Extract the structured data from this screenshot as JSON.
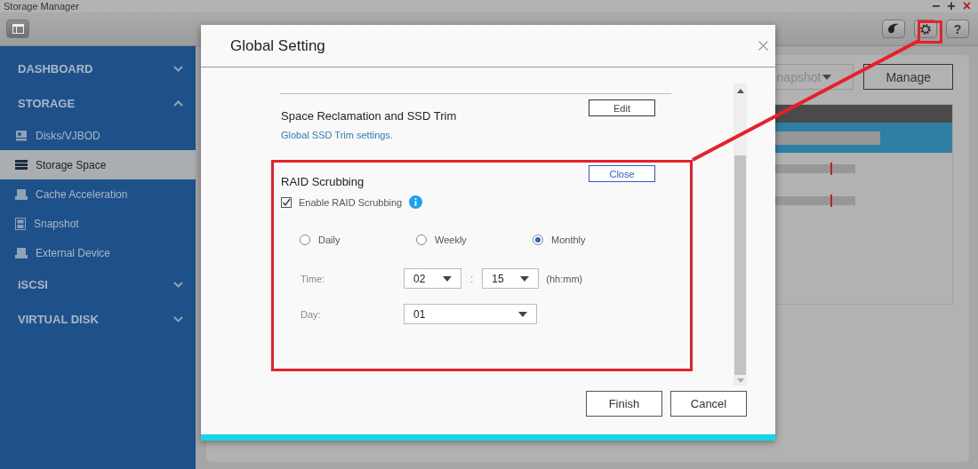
{
  "window": {
    "title": "Storage Manager",
    "controls": [
      "−",
      "+",
      "×"
    ]
  },
  "toolbar": {
    "help": "?"
  },
  "sidebar": {
    "sections": [
      {
        "label": "DASHBOARD",
        "expanded": false
      },
      {
        "label": "STORAGE",
        "expanded": true,
        "items": [
          {
            "label": "Disks/VJBOD",
            "selected": false
          },
          {
            "label": "Storage Space",
            "selected": true
          },
          {
            "label": "Cache Acceleration",
            "selected": false
          },
          {
            "label": "Snapshot",
            "selected": false
          },
          {
            "label": "External Device",
            "selected": false
          }
        ]
      },
      {
        "label": "iSCSI",
        "expanded": false
      },
      {
        "label": "VIRTUAL DISK",
        "expanded": false
      }
    ]
  },
  "background": {
    "actions": [
      {
        "label": "napshot",
        "kind": "dropdown"
      },
      {
        "label": "Manage",
        "kind": "button"
      }
    ],
    "table": {
      "rows": [
        {
          "selected": true
        },
        {
          "selected": false
        },
        {
          "selected": false
        }
      ]
    }
  },
  "dialog": {
    "title": "Global Setting",
    "sections": [
      {
        "title": "Space Reclamation and SSD Trim",
        "link": "Global SSD Trim settings.",
        "button": "Edit",
        "expanded": false
      },
      {
        "title": "RAID Scrubbing",
        "button": "Close",
        "expanded": true,
        "enable": {
          "label": "Enable RAID Scrubbing",
          "checked": true
        },
        "frequency": [
          {
            "label": "Daily",
            "selected": false
          },
          {
            "label": "Weekly",
            "selected": false
          },
          {
            "label": "Monthly",
            "selected": true
          }
        ],
        "time": {
          "label": "Time:",
          "hour": "02",
          "separator": ":",
          "minute": "15",
          "unit": "(hh:mm)"
        },
        "day": {
          "label": "Day:",
          "value": "01"
        }
      }
    ],
    "buttons": [
      "Finish",
      "Cancel"
    ]
  }
}
